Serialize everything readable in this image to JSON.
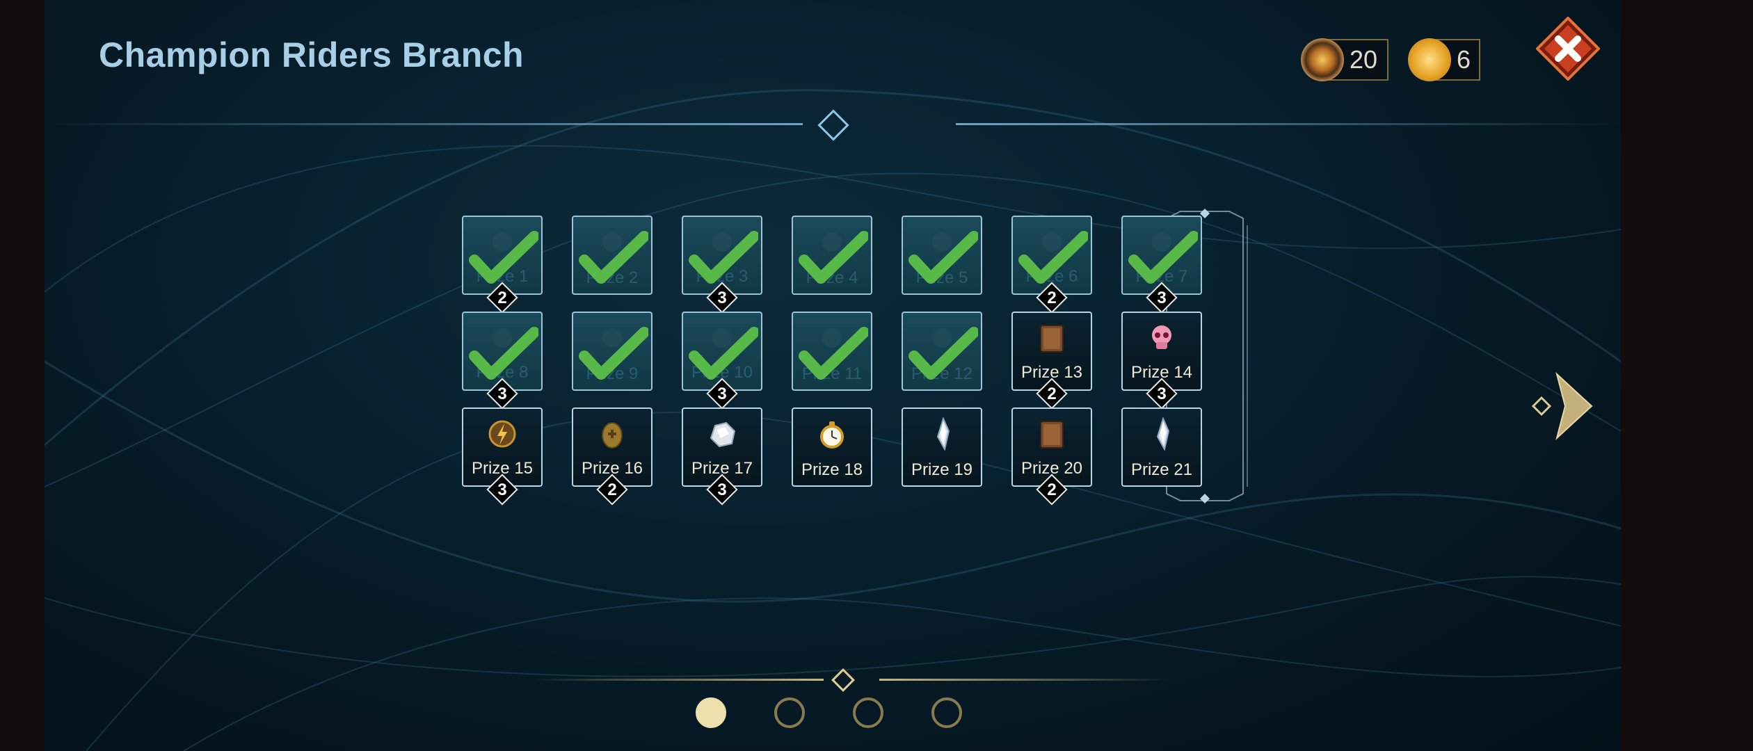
{
  "header": {
    "title": "Champion Riders Branch"
  },
  "currencies": [
    {
      "icon": "championship-token-icon",
      "value": "20"
    },
    {
      "icon": "gold-triskele-coin-icon",
      "value": "6"
    }
  ],
  "prizes": [
    {
      "label": "Prize 1",
      "count": "2",
      "claimed": true,
      "icon": "prize-icon"
    },
    {
      "label": "Prize 2",
      "count": "",
      "claimed": true,
      "icon": "prize-icon"
    },
    {
      "label": "Prize 3",
      "count": "3",
      "claimed": true,
      "icon": "prize-icon"
    },
    {
      "label": "Prize 4",
      "count": "",
      "claimed": true,
      "icon": "prize-icon"
    },
    {
      "label": "Prize 5",
      "count": "",
      "claimed": true,
      "icon": "prize-icon"
    },
    {
      "label": "Prize 6",
      "count": "2",
      "claimed": true,
      "icon": "prize-icon"
    },
    {
      "label": "Prize 7",
      "count": "3",
      "claimed": true,
      "icon": "prize-icon"
    },
    {
      "label": "Prize 8",
      "count": "3",
      "claimed": true,
      "icon": "prize-icon"
    },
    {
      "label": "Prize 9",
      "count": "",
      "claimed": true,
      "icon": "prize-icon"
    },
    {
      "label": "Prize 10",
      "count": "3",
      "claimed": true,
      "icon": "prize-icon"
    },
    {
      "label": "Prize 11",
      "count": "",
      "claimed": true,
      "icon": "prize-icon"
    },
    {
      "label": "Prize 12",
      "count": "",
      "claimed": true,
      "icon": "prize-icon"
    },
    {
      "label": "Prize 13",
      "count": "2",
      "claimed": false,
      "icon": "leather-tome-icon"
    },
    {
      "label": "Prize 14",
      "count": "3",
      "claimed": false,
      "icon": "pink-skull-icon"
    },
    {
      "label": "Prize 15",
      "count": "3",
      "claimed": false,
      "icon": "lightning-medallion-icon"
    },
    {
      "label": "Prize 16",
      "count": "2",
      "claimed": false,
      "icon": "golden-egg-icon"
    },
    {
      "label": "Prize 17",
      "count": "3",
      "claimed": false,
      "icon": "silver-ore-icon"
    },
    {
      "label": "Prize 18",
      "count": "",
      "claimed": false,
      "icon": "pocket-watch-icon"
    },
    {
      "label": "Prize 19",
      "count": "",
      "claimed": false,
      "icon": "crystal-shard-icon"
    },
    {
      "label": "Prize 20",
      "count": "2",
      "claimed": false,
      "icon": "leather-tome-icon"
    },
    {
      "label": "Prize 21",
      "count": "",
      "claimed": false,
      "icon": "crystal-shard-icon"
    }
  ],
  "pagination": {
    "pages": 4,
    "current": 1
  },
  "colors": {
    "title": "#a9cfe6",
    "check": "#58b848",
    "accent_gold": "#ede0ac",
    "close": "#c8401f"
  }
}
